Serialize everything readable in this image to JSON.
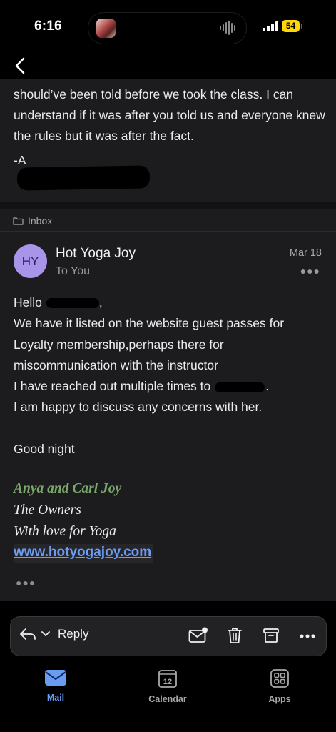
{
  "status_bar": {
    "time": "6:16",
    "battery": "54"
  },
  "quoted_email": {
    "text": "should’ve been told before we took the class. I can understand if it was after you told us and everyone knew the rules but it was after the fact.",
    "signature_prefix": "-A"
  },
  "folder": {
    "label": "Inbox"
  },
  "message": {
    "avatar_initials": "HY",
    "sender": "Hot Yoga Joy",
    "recipient": "To You",
    "date": "Mar 18",
    "greeting": "Hello",
    "greeting_suffix": ",",
    "body_line1": "We have it listed on the website guest passes for",
    "body_line2": "Loyalty membership,perhaps there for",
    "body_line3": "miscommunication with the instructor",
    "body_line4": " I have reached out multiple times to",
    "body_line4_suffix": ".",
    "body_line5": "I am happy to discuss any concerns with her.",
    "closing": "Good night",
    "signature": {
      "names": "Anya and Carl Joy",
      "title": "The Owners",
      "tagline": "With love for Yoga",
      "link": "www.hotyogajoy.com"
    }
  },
  "reply_bar": {
    "reply_label": "Reply"
  },
  "tabs": [
    {
      "label": "Mail"
    },
    {
      "label": "Calendar",
      "calendar_day": "12"
    },
    {
      "label": "Apps"
    }
  ],
  "colors": {
    "accent": "#6a9cf2",
    "avatar": "#a894e8",
    "signature_green": "#7aa86a",
    "battery": "#ffd60a"
  }
}
